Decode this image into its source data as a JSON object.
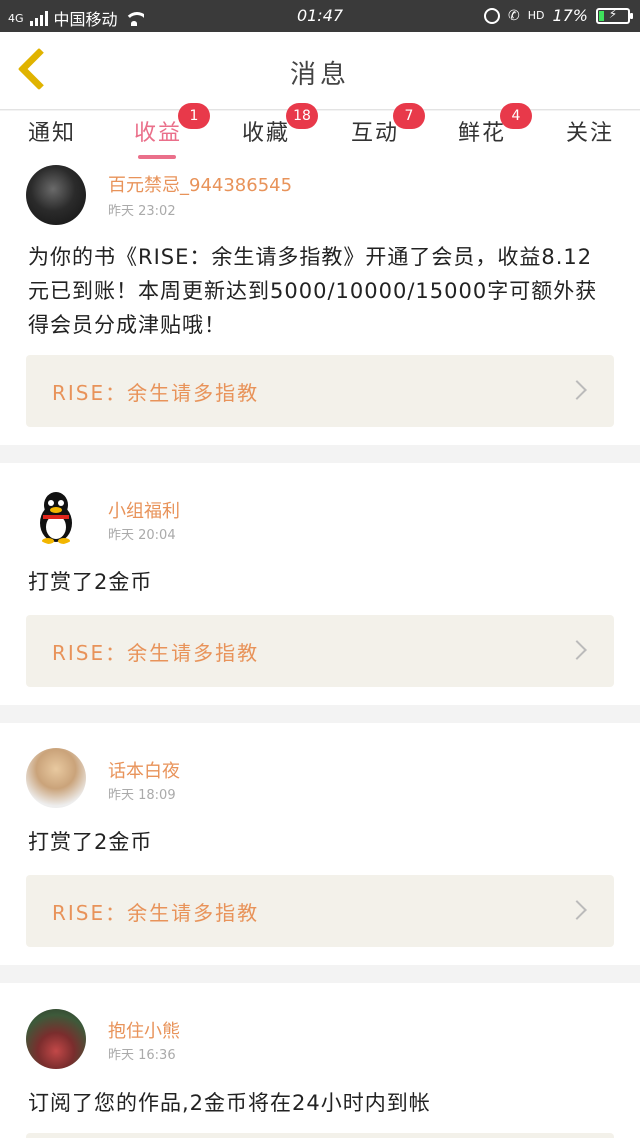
{
  "status_bar": {
    "network": "4G",
    "carrier": "中国移动",
    "time": "01:47",
    "hd": "HD",
    "battery_percent": "17%",
    "battery_level": 0.17
  },
  "header": {
    "title": "消息"
  },
  "tabs": [
    {
      "label": "通知",
      "badge": ""
    },
    {
      "label": "收益",
      "badge": "1"
    },
    {
      "label": "收藏",
      "badge": "18"
    },
    {
      "label": "互动",
      "badge": "7"
    },
    {
      "label": "鲜花",
      "badge": "4"
    },
    {
      "label": "关注",
      "badge": ""
    }
  ],
  "messages": [
    {
      "user": "百元禁忌_944386545",
      "time": "昨天 23:02",
      "text": "为你的书《RISE：余生请多指教》开通了会员，收益8.12元已到账！本周更新达到5000/10000/15000字可额外获得会员分成津贴哦！",
      "book": "RISE：余生请多指教"
    },
    {
      "user": "小组福利",
      "time": "昨天 20:04",
      "text": "打赏了2金币",
      "book": "RISE：余生请多指教"
    },
    {
      "user": "话本白夜",
      "time": "昨天 18:09",
      "text": "打赏了2金币",
      "book": "RISE：余生请多指教"
    },
    {
      "user": "抱住小熊",
      "time": "昨天 16:36",
      "text": "订阅了您的作品,2金币将在24小时内到帐"
    }
  ]
}
